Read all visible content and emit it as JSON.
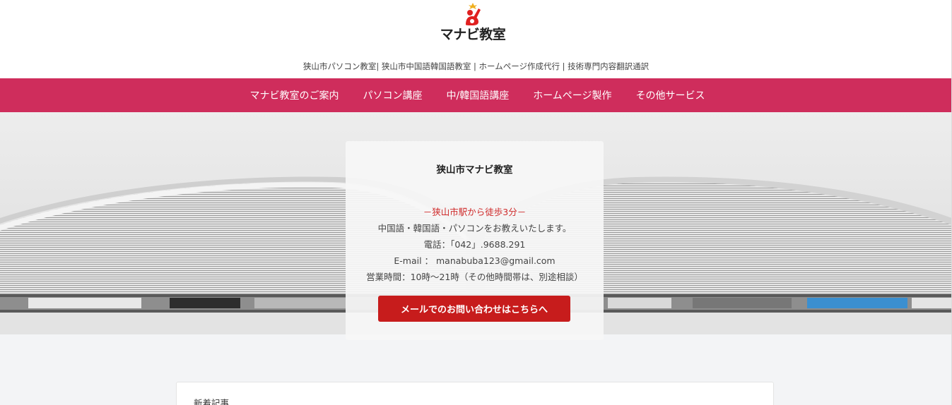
{
  "site": {
    "logo_text": "マナビ教室",
    "tagline": "狭山市パソコン教室| 狭山市中国語韓国語教室 | ホームページ作成代行 | 技術専門内容翻訳通訳"
  },
  "nav": {
    "items": [
      {
        "label": "マナビ教室のご案内"
      },
      {
        "label": "パソコン講座"
      },
      {
        "label": "中/韓国語講座"
      },
      {
        "label": "ホームページ製作"
      },
      {
        "label": "その他サービス"
      }
    ]
  },
  "card": {
    "title": "狭山市マナビ教室",
    "access": "－狭山市駅から徒歩3分－",
    "description": "中国語・韓国語・パソコンをお教えいたします。",
    "phone": "電話：「042」.9688.291",
    "email": "E-mail ： manabuba123@gmail.com",
    "hours": "営業時間：10時～21時（その他時間帯は、別途相談）",
    "cta_label": "メールでのお問い合わせはこちらへ"
  },
  "news": {
    "title": "新着記事"
  },
  "colors": {
    "nav_bg": "#cf2d5c",
    "cta_bg": "#c71c1c",
    "access_text": "#cf2a2a",
    "logo_accent": "#e02020"
  },
  "icons": {
    "logo_mark": "person-raising-hand-icon"
  }
}
